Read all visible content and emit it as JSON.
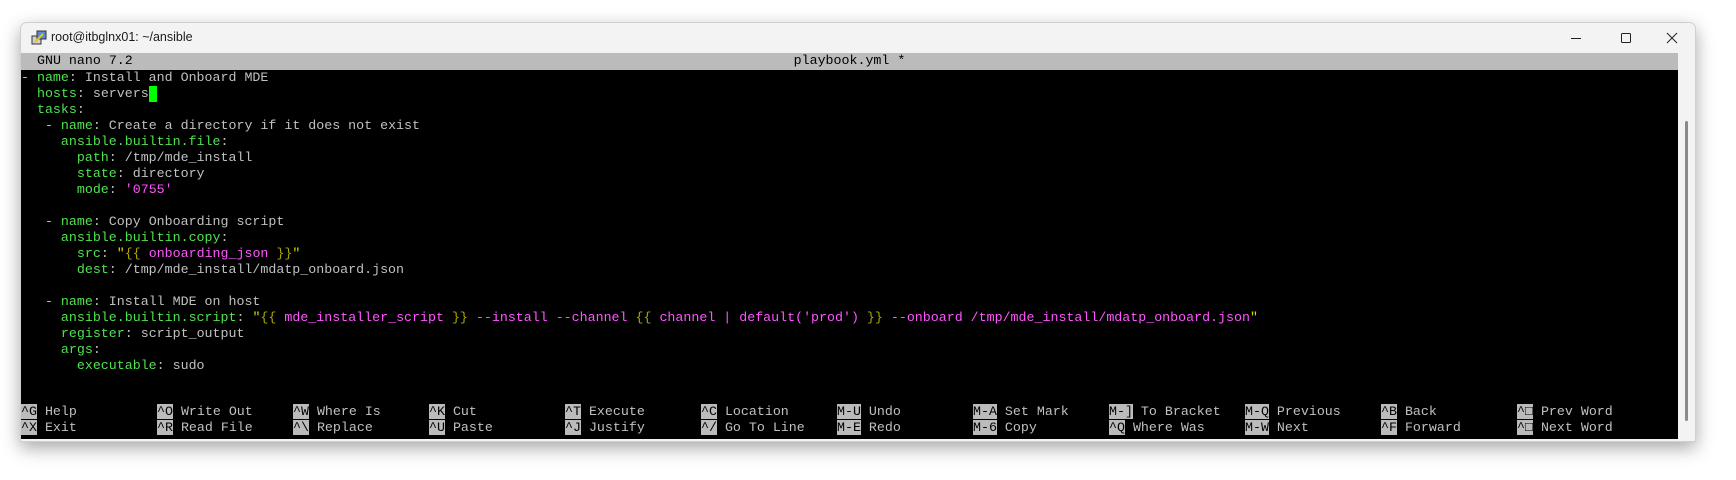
{
  "window": {
    "title": "root@itbglnx01: ~/ansible",
    "controls": [
      "minimize",
      "maximize",
      "close"
    ]
  },
  "nano": {
    "version": "GNU nano 7.2",
    "filename": "playbook.yml *"
  },
  "colors": {
    "key": "#4fe34f",
    "value": "#c0c0c0",
    "string": "#ff55ff",
    "dash": "#d8d800",
    "cursor": "#00ff00"
  },
  "editor_lines": [
    [
      {
        "t": "- ",
        "c": "d"
      },
      {
        "t": "name",
        "c": "k"
      },
      {
        "t": ": Install and Onboard MDE",
        "c": "v"
      }
    ],
    [
      {
        "t": "  "
      },
      {
        "t": "hosts",
        "c": "k"
      },
      {
        "t": ": servers",
        "c": "v"
      },
      {
        "cursor": true
      }
    ],
    [
      {
        "t": "  "
      },
      {
        "t": "tasks",
        "c": "k"
      },
      {
        "t": ":",
        "c": "p"
      }
    ],
    [
      {
        "t": "   "
      },
      {
        "t": "- ",
        "c": "d"
      },
      {
        "t": "name",
        "c": "k"
      },
      {
        "t": ": Create a directory if it does not exist",
        "c": "v"
      }
    ],
    [
      {
        "t": "     "
      },
      {
        "t": "ansible.builtin.file",
        "c": "k"
      },
      {
        "t": ":",
        "c": "p"
      }
    ],
    [
      {
        "t": "       "
      },
      {
        "t": "path",
        "c": "k"
      },
      {
        "t": ": /tmp/mde_install",
        "c": "v"
      }
    ],
    [
      {
        "t": "       "
      },
      {
        "t": "state",
        "c": "k"
      },
      {
        "t": ": directory",
        "c": "v"
      }
    ],
    [
      {
        "t": "       "
      },
      {
        "t": "mode",
        "c": "k"
      },
      {
        "t": ": ",
        "c": "p"
      },
      {
        "t": "'0755'",
        "c": "s"
      }
    ],
    [],
    [
      {
        "t": "   "
      },
      {
        "t": "- ",
        "c": "d"
      },
      {
        "t": "name",
        "c": "k"
      },
      {
        "t": ": Copy Onboarding script",
        "c": "v"
      }
    ],
    [
      {
        "t": "     "
      },
      {
        "t": "ansible.builtin.copy",
        "c": "k"
      },
      {
        "t": ":",
        "c": "p"
      }
    ],
    [
      {
        "t": "       "
      },
      {
        "t": "src",
        "c": "k"
      },
      {
        "t": ": ",
        "c": "p"
      },
      {
        "t": "\"",
        "c": "q"
      },
      {
        "t": "{{",
        "c": "b"
      },
      {
        "t": " onboarding_json ",
        "c": "s"
      },
      {
        "t": "}}",
        "c": "b"
      },
      {
        "t": "\"",
        "c": "q"
      }
    ],
    [
      {
        "t": "       "
      },
      {
        "t": "dest",
        "c": "k"
      },
      {
        "t": ": /tmp/mde_install/mdatp_onboard.json",
        "c": "v"
      }
    ],
    [],
    [
      {
        "t": "   "
      },
      {
        "t": "- ",
        "c": "d"
      },
      {
        "t": "name",
        "c": "k"
      },
      {
        "t": ": Install MDE on host",
        "c": "v"
      }
    ],
    [
      {
        "t": "     "
      },
      {
        "t": "ansible.builtin.script",
        "c": "k"
      },
      {
        "t": ": ",
        "c": "p"
      },
      {
        "t": "\"",
        "c": "q"
      },
      {
        "t": "{{",
        "c": "b"
      },
      {
        "t": " mde_installer_script ",
        "c": "s"
      },
      {
        "t": "}}",
        "c": "b"
      },
      {
        "t": " --install --channel ",
        "c": "s"
      },
      {
        "t": "{{",
        "c": "b"
      },
      {
        "t": " channel | default('prod') ",
        "c": "s"
      },
      {
        "t": "}}",
        "c": "b"
      },
      {
        "t": " --onboard /tmp/mde_install/mdatp_onboard.json",
        "c": "s"
      },
      {
        "t": "\"",
        "c": "q"
      }
    ],
    [
      {
        "t": "     "
      },
      {
        "t": "register",
        "c": "k"
      },
      {
        "t": ": script_output",
        "c": "v"
      }
    ],
    [
      {
        "t": "     "
      },
      {
        "t": "args",
        "c": "k"
      },
      {
        "t": ":",
        "c": "p"
      }
    ],
    [
      {
        "t": "       "
      },
      {
        "t": "executable",
        "c": "k"
      },
      {
        "t": ": sudo",
        "c": "v"
      }
    ]
  ],
  "shortcuts": [
    [
      {
        "key": "^G",
        "label": "Help"
      },
      {
        "key": "^O",
        "label": "Write Out"
      },
      {
        "key": "^W",
        "label": "Where Is"
      },
      {
        "key": "^K",
        "label": "Cut"
      },
      {
        "key": "^T",
        "label": "Execute"
      },
      {
        "key": "^C",
        "label": "Location"
      },
      {
        "key": "M-U",
        "label": "Undo"
      },
      {
        "key": "M-A",
        "label": "Set Mark"
      },
      {
        "key": "M-]",
        "label": "To Bracket"
      },
      {
        "key": "M-Q",
        "label": "Previous"
      },
      {
        "key": "^B",
        "label": "Back"
      },
      {
        "key": "^□",
        "label": "Prev Word"
      }
    ],
    [
      {
        "key": "^X",
        "label": "Exit"
      },
      {
        "key": "^R",
        "label": "Read File"
      },
      {
        "key": "^\\",
        "label": "Replace"
      },
      {
        "key": "^U",
        "label": "Paste"
      },
      {
        "key": "^J",
        "label": "Justify"
      },
      {
        "key": "^/",
        "label": "Go To Line"
      },
      {
        "key": "M-E",
        "label": "Redo"
      },
      {
        "key": "M-6",
        "label": "Copy"
      },
      {
        "key": "^Q",
        "label": "Where Was"
      },
      {
        "key": "M-W",
        "label": "Next"
      },
      {
        "key": "^F",
        "label": "Forward"
      },
      {
        "key": "^□",
        "label": "Next Word"
      }
    ]
  ]
}
